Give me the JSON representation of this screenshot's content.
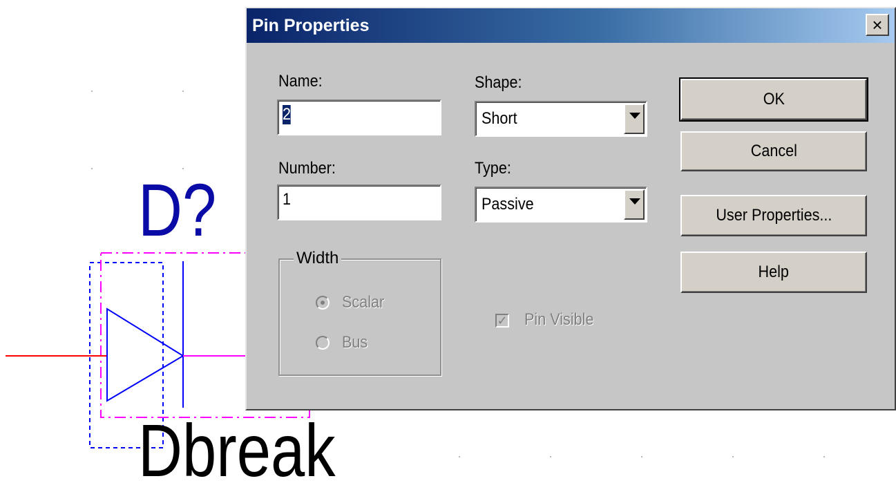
{
  "canvas": {
    "refdes": "D?",
    "part_value": "Dbreak",
    "colors": {
      "pin_wire": "#ff0000",
      "body": "#0000ff",
      "selection": "#ff00ff",
      "refdes": "#0a0aa6"
    }
  },
  "dialog": {
    "title": "Pin Properties",
    "close_label": "×",
    "name": {
      "label": "Name:",
      "value": "2"
    },
    "number": {
      "label": "Number:",
      "value": "1"
    },
    "shape": {
      "label": "Shape:",
      "selected": "Short"
    },
    "type": {
      "label": "Type:",
      "selected": "Passive"
    },
    "width": {
      "legend": "Width",
      "options": [
        "Scalar",
        "Bus"
      ],
      "selected": "Scalar"
    },
    "pin_visible": {
      "label": "Pin Visible",
      "checked": true,
      "check_glyph": "✓"
    },
    "buttons": {
      "ok": "OK",
      "cancel": "Cancel",
      "user_properties": "User Properties...",
      "help": "Help"
    },
    "colors": {
      "title_start": "#0a246a",
      "title_end": "#a6caf0",
      "face": "#c6c6c6"
    }
  }
}
